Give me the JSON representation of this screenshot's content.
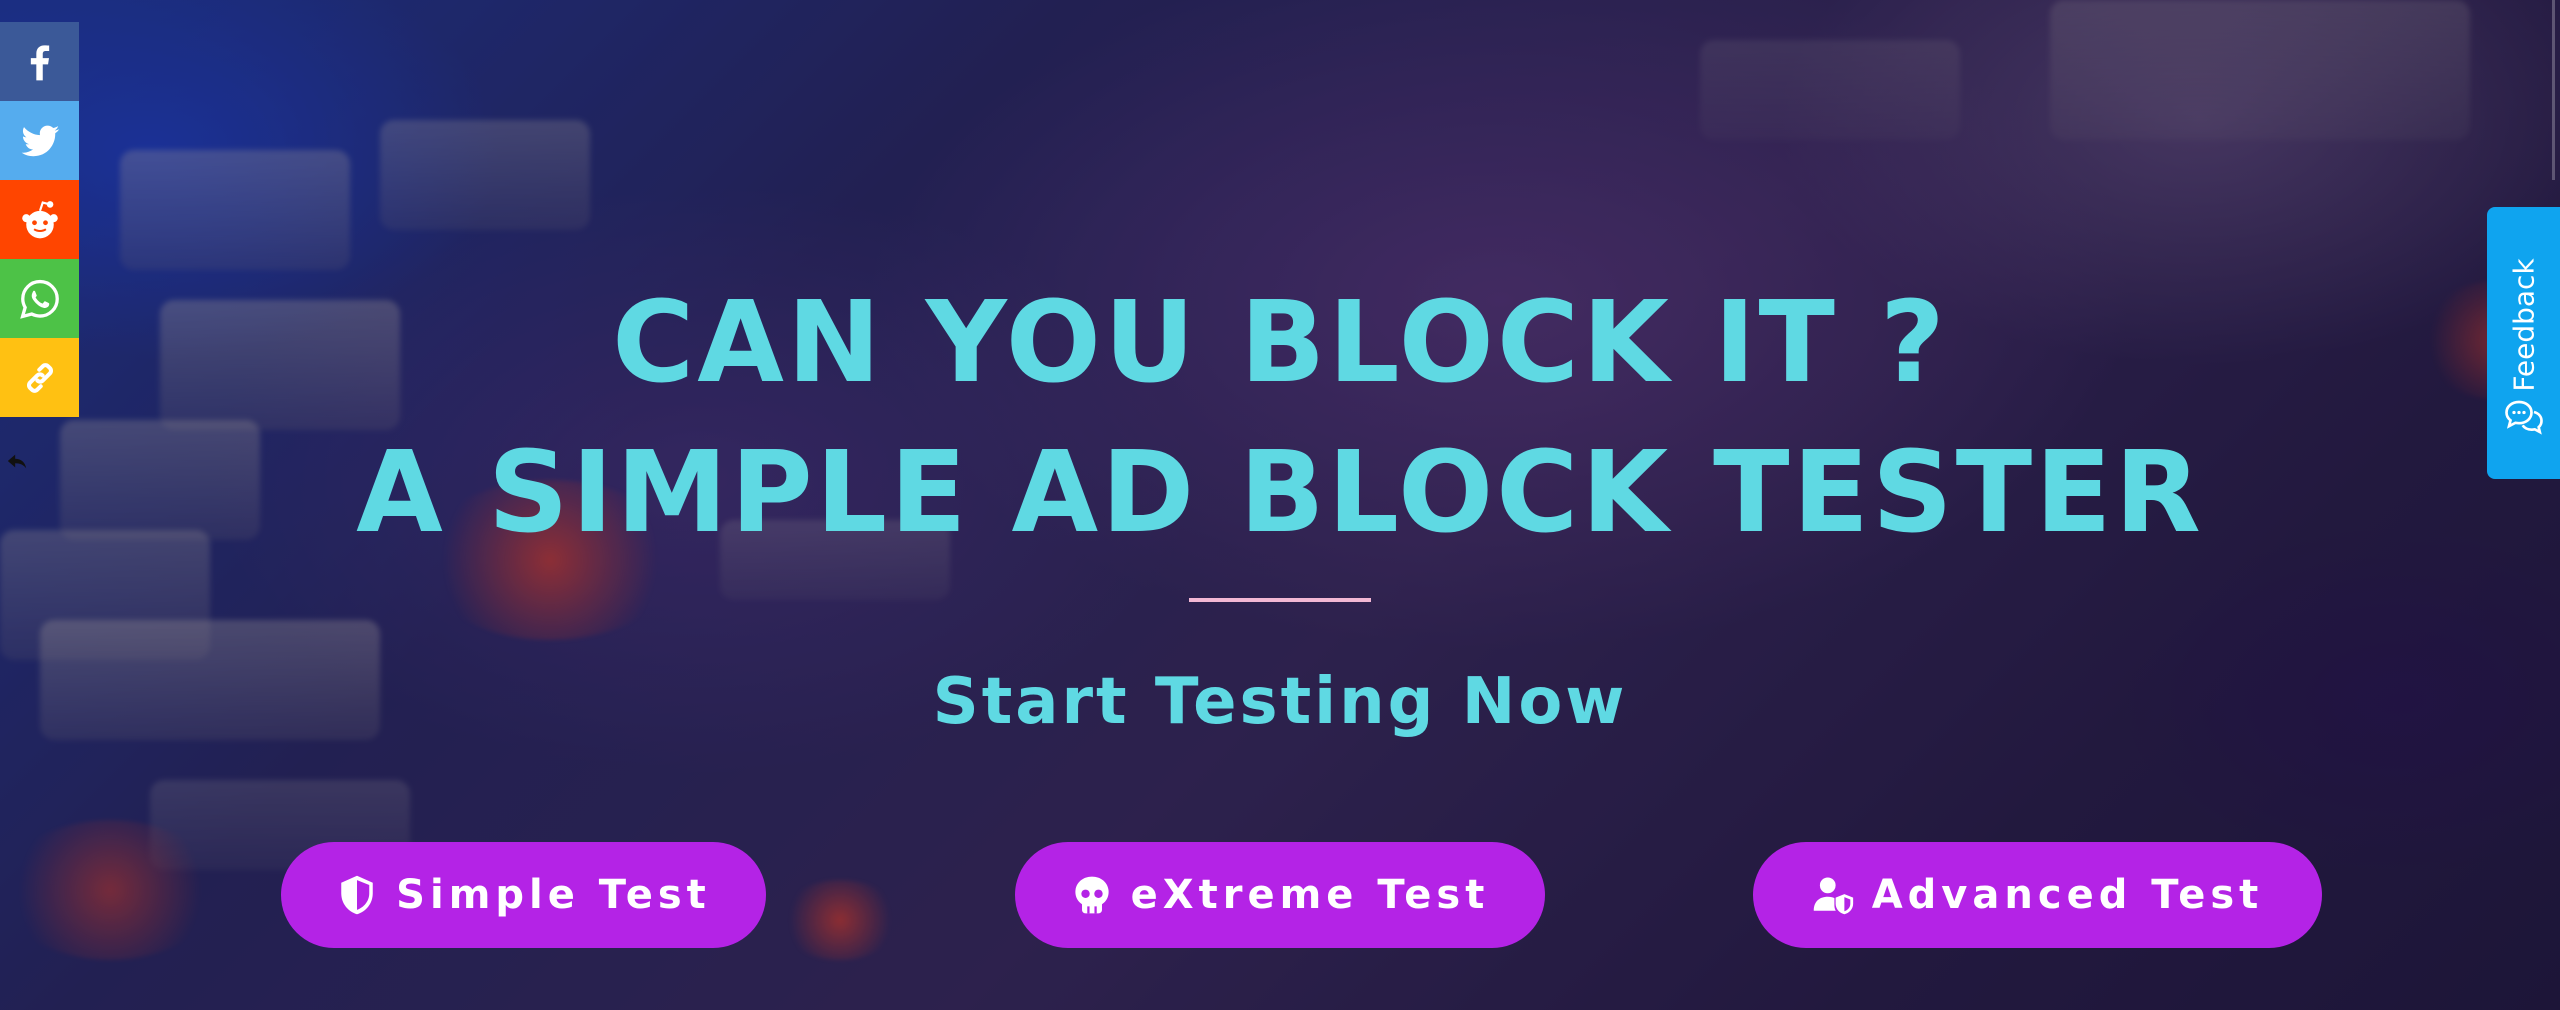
{
  "hero": {
    "headline_line1": "CAN YOU BLOCK IT ?",
    "headline_line2": "A SIMPLE AD BLOCK TESTER",
    "subtitle": "Start Testing Now"
  },
  "buttons": {
    "simple_label": "Simple Test",
    "extreme_label": "eXtreme Test",
    "advanced_label": "Advanced Test"
  },
  "share_bar": {
    "items": [
      {
        "network": "facebook",
        "icon": "facebook-icon",
        "color": "#3b5998"
      },
      {
        "network": "twitter",
        "icon": "twitter-icon",
        "color": "#55acee"
      },
      {
        "network": "reddit",
        "icon": "reddit-icon",
        "color": "#ff4500"
      },
      {
        "network": "whatsapp",
        "icon": "whatsapp-icon",
        "color": "#4dc247"
      },
      {
        "network": "copy-link",
        "icon": "link-icon",
        "color": "#ffc112"
      }
    ]
  },
  "feedback": {
    "label": "Feedback",
    "color": "#0fa4ef"
  },
  "colors": {
    "headline": "#5fd9e3",
    "button": "#b423e6",
    "divider": "#f3b8d4"
  }
}
